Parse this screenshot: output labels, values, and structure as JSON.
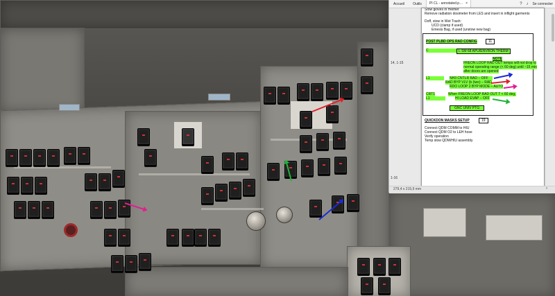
{
  "tabs": {
    "home": "Accueil",
    "tools": "Outils",
    "document": "PI CL - annotated.p…",
    "close": "×",
    "signin": "Se connecter"
  },
  "document": {
    "line_1": "Stow gloves in Helmet",
    "line_2": "Remove radiation dosimeter from LES and insert in inflight garments",
    "line_3": "Doff, stow in Wet Trash:",
    "line_4": "UCD (clamp if used)",
    "line_5": "Emesis Bag, if used (unstow new bag)",
    "section_1": "POST PLBD OPS RAD CONFIG",
    "section_1_num": "11",
    "c_label": "C",
    "item_1": "L  SM 68 APU/ENVRON THERM",
    "note_label": "NOTE",
    "note_1": "FREON LOOP RAD OUT temps will not drop to",
    "note_2": "normal operating range (< 60 deg) until ~15 min",
    "note_3": "after doors are opened",
    "l1_label": "L1",
    "l1_line_1": "NH3 CNTLR RAD – OFF",
    "l1_line_2": "RAD BYP VLV (b (two) – RAD",
    "l1_line_3": "RDO LOOP 2 BYP MODE – AUTO",
    "crt1_label": "CRT1",
    "crt1_line": "When FREON LOOP RAD OUT T < 60 deg,",
    "l1b_label": "L1",
    "l1b_line": "HI LOAD EVAP – OFF",
    "gnc_line": "GNC UNIV PTG",
    "section_2": "QUICKDON MASKS SETUP",
    "section_2_num": "19",
    "q_line_1": "Connect QDM COMM to HIU",
    "q_line_2": "Connect QDM O2 to LEH hose",
    "q_line_3": "Verify operation",
    "q_line_4": "Temp stow QDM/HIU assembly"
  },
  "side": {
    "page_ref_1": "14, 1-15",
    "page_ref_2": "1-16"
  },
  "status": {
    "dimensions": "279,4 x 215,9 mm"
  },
  "annotations": {
    "blue": "#1a2bd8",
    "red": "#e0212a",
    "green": "#22b43a",
    "magenta": "#e0208f"
  }
}
